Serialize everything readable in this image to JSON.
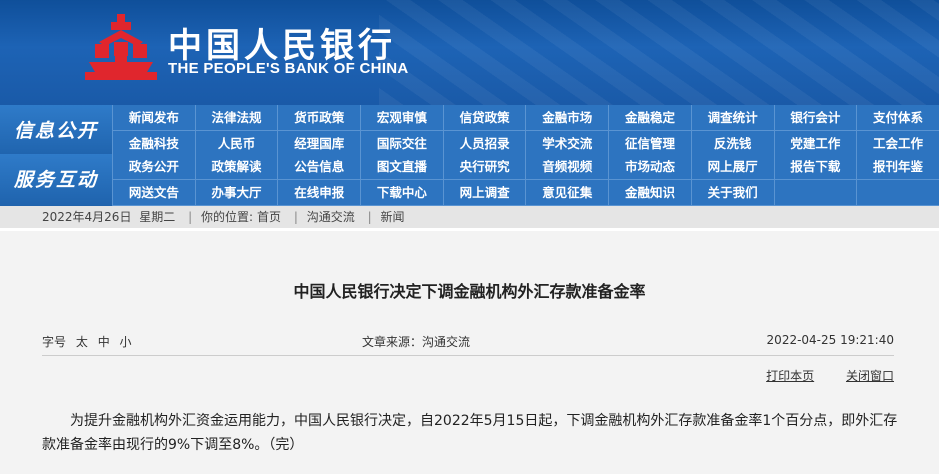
{
  "header": {
    "name_cn": "中国人民银行",
    "name_en": "THE PEOPLE'S BANK OF CHINA",
    "colors": {
      "brand_blue": "#1d63b5",
      "logo_red": "#e0262d"
    }
  },
  "nav": [
    {
      "label": "信息公开",
      "items": [
        "新闻发布",
        "法律法规",
        "货币政策",
        "宏观审慎",
        "信贷政策",
        "金融市场",
        "金融稳定",
        "调查统计",
        "银行会计",
        "支付体系",
        "金融科技",
        "人民币",
        "经理国库",
        "国际交往",
        "人员招录",
        "学术交流",
        "征信管理",
        "反洗钱",
        "党建工作",
        "工会工作"
      ]
    },
    {
      "label": "服务互动",
      "items": [
        "政务公开",
        "政策解读",
        "公告信息",
        "图文直播",
        "央行研究",
        "音频视频",
        "市场动态",
        "网上展厅",
        "报告下载",
        "报刊年鉴",
        "网送文告",
        "办事大厅",
        "在线申报",
        "下载中心",
        "网上调查",
        "意见征集",
        "金融知识",
        "关于我们",
        "",
        ""
      ]
    }
  ],
  "breadcrumb": {
    "date": "2022年4月26日",
    "weekday": "星期二",
    "location_label": "你的位置:",
    "items": [
      "首页",
      "沟通交流",
      "新闻"
    ]
  },
  "article": {
    "title": "中国人民银行决定下调金融机构外汇存款准备金率",
    "font_size_label": "字号",
    "font_sizes": [
      "太",
      "中",
      "小"
    ],
    "source": "文章来源：沟通交流",
    "datetime": "2022-04-25  19:21:40",
    "print_label": "打印本页",
    "close_label": "关闭窗口",
    "body": "为提升金融机构外汇资金运用能力，中国人民银行决定，自2022年5月15日起，下调金融机构外汇存款准备金率1个百分点，即外汇存款准备金率由现行的9%下调至8%。（完）"
  }
}
